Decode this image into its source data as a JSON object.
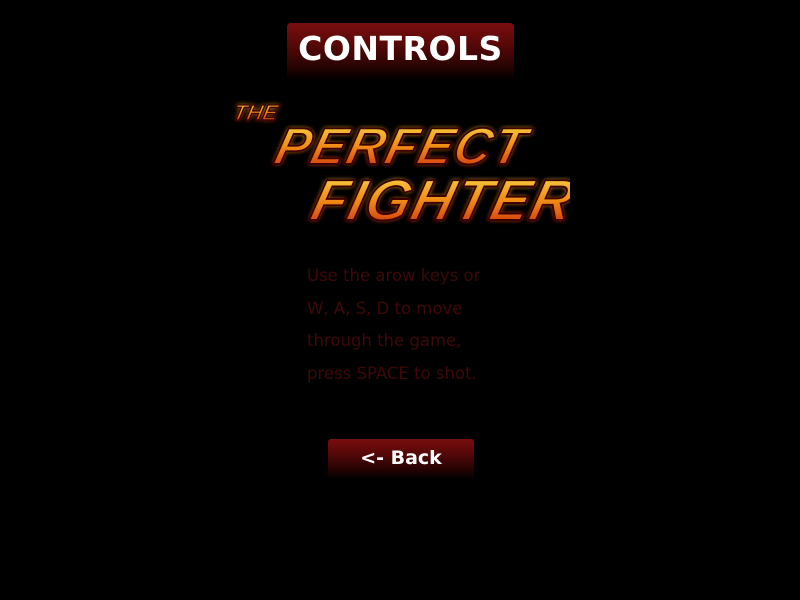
{
  "screen": {
    "title": "CONTROLS"
  },
  "logo": {
    "line1": "THE",
    "line2": "PERFECT",
    "line3": "FIGHTER",
    "fill_top": "#f7e04a",
    "fill_mid": "#f08a16",
    "fill_bottom": "#c71e0c",
    "outline": "#3a0000"
  },
  "instructions": {
    "lines": [
      " Use the arow keys or",
      "W, A, S, D to move",
      "through the game,",
      "press SPACE to shot."
    ]
  },
  "back_button": {
    "label": "<- Back"
  },
  "colors": {
    "background": "#000000",
    "banner": "#6b0c0c",
    "instruction_text": "#3e0808"
  }
}
